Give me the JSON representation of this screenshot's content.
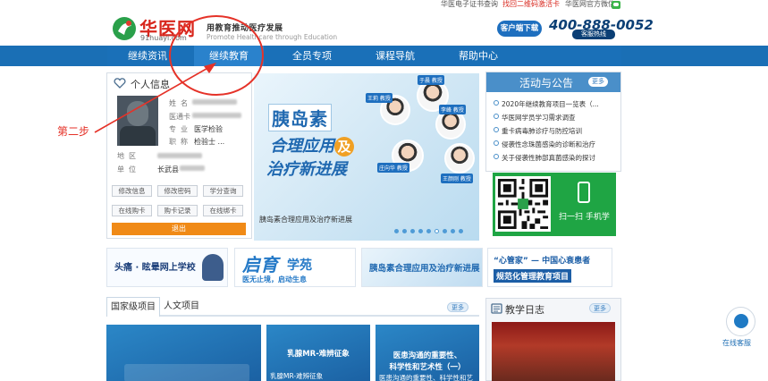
{
  "topbar": {
    "cert_query": "华医电子证书查询",
    "find_qr": "找回二维码激活卡",
    "wechat": "华医网官方微信"
  },
  "header": {
    "logo_text": "华医网",
    "logo_sub": "91huayi.com",
    "slogan": "用教育推动医疗发展",
    "slogan_en": "Promote Healthcare through Education",
    "client_download": "客户端下载",
    "hotline": "400-888-0052",
    "hotline_label": "客服热线"
  },
  "nav": {
    "items": [
      "继续资讯",
      "继续教育",
      "全员专项",
      "课程导航",
      "帮助中心"
    ],
    "active": "继续教育"
  },
  "annotation": {
    "step": "第二步"
  },
  "profile": {
    "title": "个人信息",
    "fields": [
      {
        "label": "姓名",
        "value": ""
      },
      {
        "label": "医通卡",
        "value": ""
      },
      {
        "label": "专业",
        "value": "医学检验"
      },
      {
        "label": "职称",
        "value": "检验士 ..."
      },
      {
        "label": "地区",
        "value": ""
      },
      {
        "label": "单位",
        "value": "长武县"
      }
    ],
    "buttons": [
      "修改信息",
      "修改密码",
      "学分查询",
      "在线购卡",
      "购卡记录",
      "在线绑卡"
    ],
    "logout": "退出"
  },
  "banner": {
    "line1": "胰岛素",
    "line2a": "合理应用",
    "ji": "及",
    "line3": "治疗新进展",
    "caption": "胰岛素合理应用及治疗新进展",
    "doctor_tags": [
      "于晨 教授",
      "王莉 教授",
      "李峰 教授",
      "庄向华 教授",
      "王颜刚 教授"
    ]
  },
  "notices": {
    "title": "活动与公告",
    "more": "更多",
    "items": [
      "2020年继续教育项目一览表（...",
      "华医网学员学习需求调查",
      "重卡病毒肺诊疗与防控培训",
      "侵袭性念珠菌感染的诊断和治疗",
      "关于侵袭性肺部真菌感染的探讨"
    ]
  },
  "qr": {
    "text": "扫一扫 手机学"
  },
  "promos": {
    "p1": "头痛 · 眩晕网上学校",
    "p2a": "启育",
    "p2b": "学苑",
    "p2c": "医无止境，启动生息",
    "p3": "胰岛素合理应用及治疗新进展",
    "p4a": "“心管家” — 中国心衰患者",
    "p4b": "规范化管理教育项目"
  },
  "courses": {
    "tabs": [
      "国家级项目",
      "人文项目"
    ],
    "more": "更多",
    "card2_title": "乳腺MR-难辨征象",
    "card2_sub": "乳腺MR-难辨征象",
    "card3_title1": "医患沟通的重要性、",
    "card3_title2": "科学性和艺术性（一）",
    "card3_sub": "医患沟通的重要性、科学性和艺"
  },
  "journal": {
    "title": "教学日志",
    "more": "更多"
  },
  "service": {
    "label": "在线客服"
  },
  "colors": {
    "nav": "#1a6fb5",
    "accent_red": "#e53228",
    "logout": "#f08a17"
  }
}
